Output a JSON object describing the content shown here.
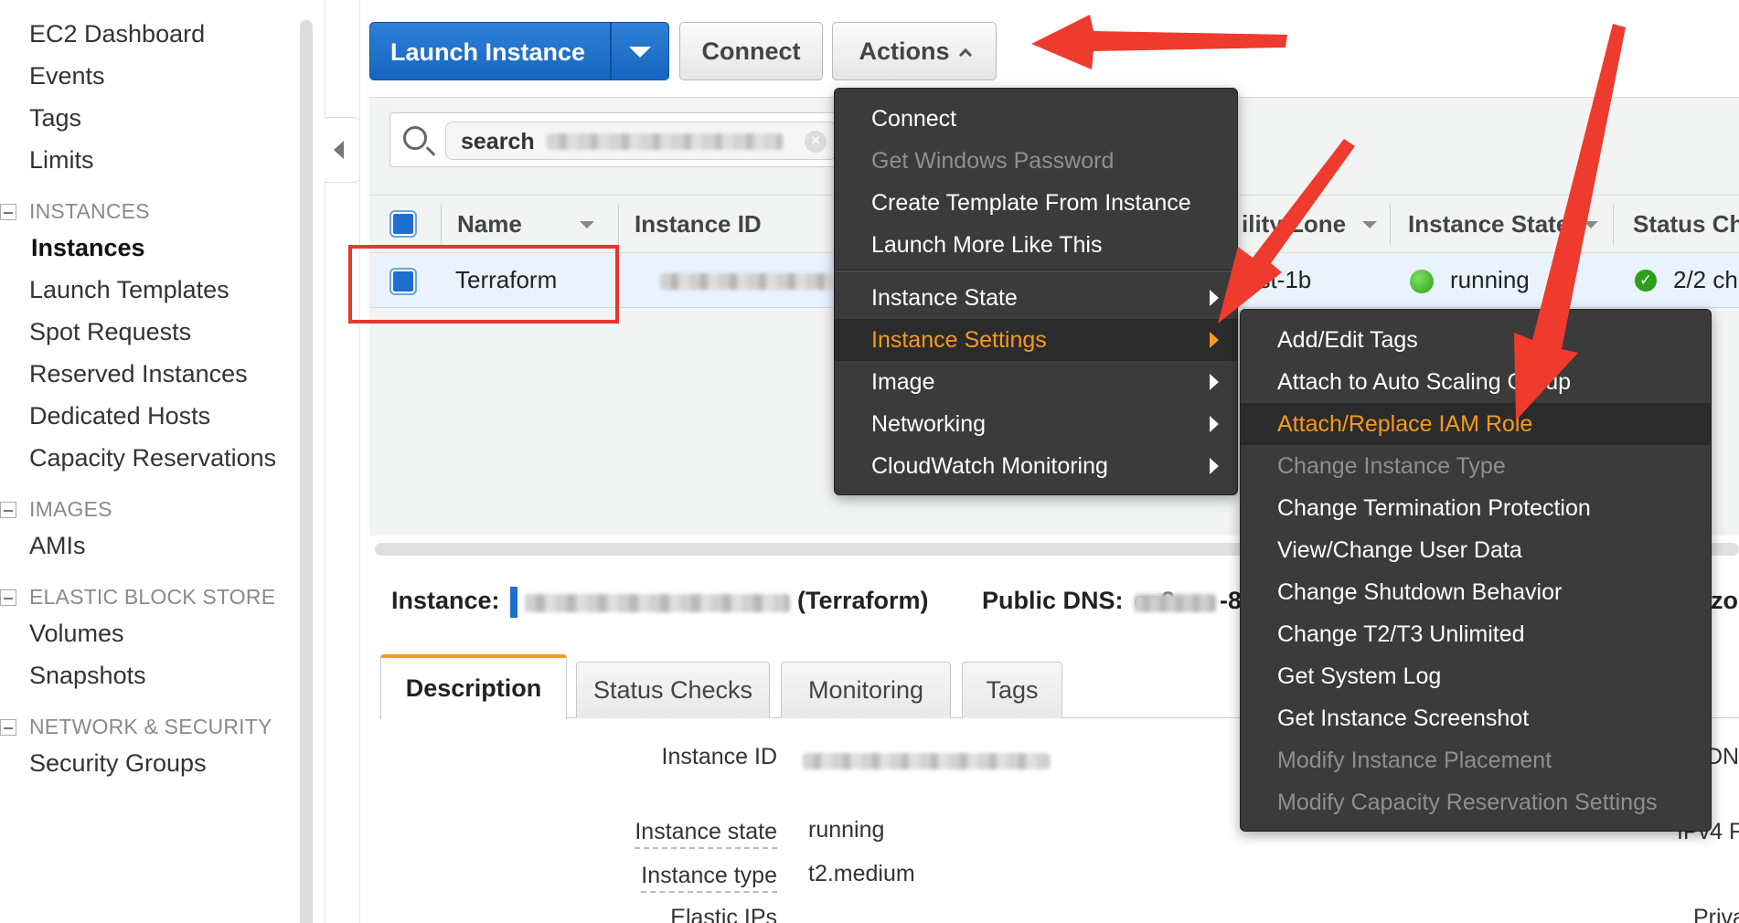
{
  "sidebar": {
    "items": [
      {
        "label": "EC2 Dashboard"
      },
      {
        "label": "Events"
      },
      {
        "label": "Tags"
      },
      {
        "label": "Limits"
      }
    ],
    "sections": [
      {
        "title": "INSTANCES",
        "items": [
          "Instances",
          "Launch Templates",
          "Spot Requests",
          "Reserved Instances",
          "Dedicated Hosts",
          "Capacity Reservations"
        ]
      },
      {
        "title": "IMAGES",
        "items": [
          "AMIs"
        ]
      },
      {
        "title": "ELASTIC BLOCK STORE",
        "items": [
          "Volumes",
          "Snapshots"
        ]
      },
      {
        "title": "NETWORK & SECURITY",
        "items": [
          "Security Groups"
        ]
      }
    ],
    "active": "Instances"
  },
  "toolbar": {
    "launch_label": "Launch Instance",
    "connect_label": "Connect",
    "actions_label": "Actions"
  },
  "search": {
    "token_label": "search"
  },
  "table": {
    "columns": [
      "Name",
      "Instance ID",
      "ility Zone",
      "Instance State",
      "Status Ch"
    ],
    "row": {
      "name": "Terraform",
      "zone": "est-1b",
      "state": "running",
      "status": "2/2 ch"
    }
  },
  "details": {
    "instance_label": "Instance:",
    "instance_name": "(Terraform)",
    "public_dns_label": "Public DNS:",
    "public_dns_prefix": "ec2-",
    "public_dns_suffix": "-8",
    "right_clip": "azo",
    "tabs": [
      "Description",
      "Status Checks",
      "Monitoring",
      "Tags"
    ],
    "fields": [
      {
        "label": "Instance ID",
        "value": ""
      },
      {
        "label": "Instance state",
        "value": "running"
      },
      {
        "label": "Instance type",
        "value": "t2.medium"
      },
      {
        "label": "Elastic IPs",
        "value": ""
      }
    ],
    "right_clips": [
      "DN",
      "IPv4 F",
      "Priva"
    ]
  },
  "actions_menu": {
    "items": [
      {
        "label": "Connect",
        "enabled": true
      },
      {
        "label": "Get Windows Password",
        "enabled": false
      },
      {
        "label": "Create Template From Instance",
        "enabled": true
      },
      {
        "label": "Launch More Like This",
        "enabled": true
      }
    ],
    "submenus": [
      {
        "label": "Instance State"
      },
      {
        "label": "Instance Settings",
        "selected": true
      },
      {
        "label": "Image"
      },
      {
        "label": "Networking"
      },
      {
        "label": "CloudWatch Monitoring"
      }
    ]
  },
  "settings_menu": {
    "items": [
      {
        "label": "Add/Edit Tags",
        "enabled": true
      },
      {
        "label": "Attach to Auto Scaling Group",
        "enabled": true
      },
      {
        "label": "Attach/Replace IAM Role",
        "enabled": true,
        "highlighted": true
      },
      {
        "label": "Change Instance Type",
        "enabled": false
      },
      {
        "label": "Change Termination Protection",
        "enabled": true
      },
      {
        "label": "View/Change User Data",
        "enabled": true
      },
      {
        "label": "Change Shutdown Behavior",
        "enabled": true
      },
      {
        "label": "Change T2/T3 Unlimited",
        "enabled": true
      },
      {
        "label": "Get System Log",
        "enabled": true
      },
      {
        "label": "Get Instance Screenshot",
        "enabled": true
      },
      {
        "label": "Modify Instance Placement",
        "enabled": false
      },
      {
        "label": "Modify Capacity Reservation Settings",
        "enabled": false
      }
    ]
  },
  "colors": {
    "primary_blue": "#1f6fcf",
    "menu_bg": "#3b3b3b",
    "menu_highlight": "#f49a1e",
    "annotation_red": "#e8372b",
    "running_green": "#2c9e1b"
  }
}
